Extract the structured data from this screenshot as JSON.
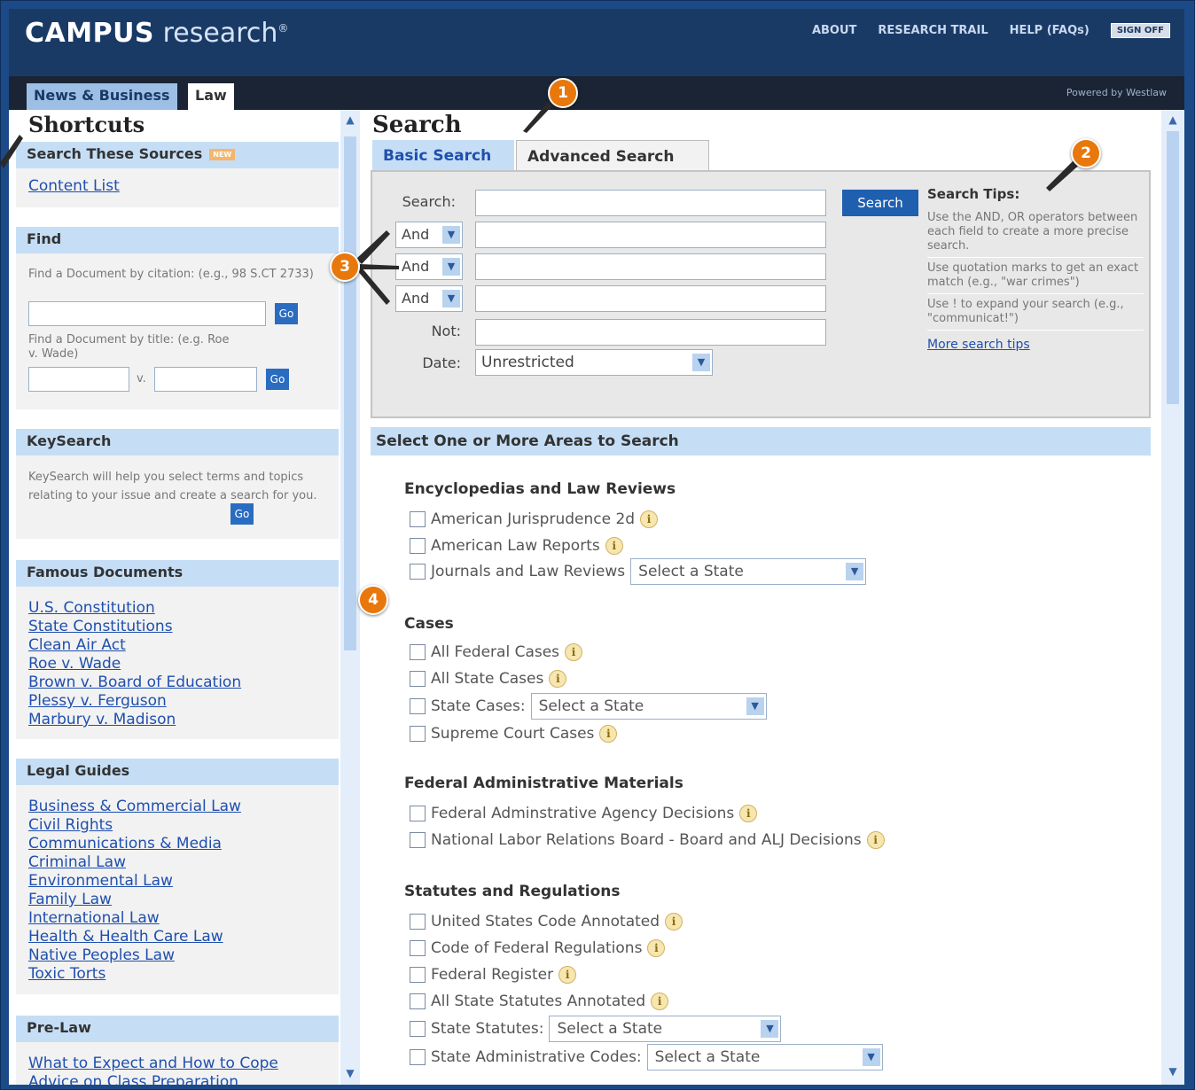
{
  "app": {
    "logo_bold": "CAMPUS",
    "logo_light": "research",
    "logo_mark": "®",
    "nav": [
      "ABOUT",
      "RESEARCH TRAIL",
      "HELP (FAQs)"
    ],
    "signoff": "SIGN OFF",
    "powered": "Powered by Westlaw",
    "tabs": [
      "News & Business",
      "Law"
    ]
  },
  "shortcuts": {
    "title": "Shortcuts",
    "sources_head": "Search These Sources",
    "new_badge": "NEW",
    "content_list": "Content List",
    "find_head": "Find",
    "find_citation_label": "Find a Document by citation: (e.g., 98 S.CT 2733)",
    "find_title_label": "Find a Document by title: (e.g. Roe v. Wade)",
    "v_label": "v.",
    "go": "Go",
    "keysearch_head": "KeySearch",
    "keysearch_text": "KeySearch will help you select terms and topics relating to your issue and create a search for you.",
    "famous_head": "Famous Documents",
    "famous": [
      "U.S. Constitution",
      "State Constitutions",
      "Clean Air Act",
      "Roe v. Wade",
      "Brown v. Board of Education",
      "Plessy v. Ferguson",
      "Marbury v. Madison"
    ],
    "guides_head": "Legal Guides",
    "guides": [
      "Business & Commercial Law",
      "Civil Rights",
      "Communications & Media",
      "Criminal Law",
      "Environmental Law",
      "Family Law",
      "International Law",
      "Health & Health Care Law",
      "Native Peoples Law",
      "Toxic Torts"
    ],
    "prelaw_head": "Pre-Law",
    "prelaw": [
      "What to Expect and How to Cope",
      "Advice on Class Preparation"
    ]
  },
  "search": {
    "title": "Search",
    "tab_basic": "Basic Search",
    "tab_advanced": "Advanced Search",
    "search_label": "Search:",
    "operators": [
      "And",
      "And",
      "And"
    ],
    "not_label": "Not:",
    "date_label": "Date:",
    "date_value": "Unrestricted",
    "button": "Search",
    "tips_title": "Search Tips:",
    "tips": [
      "Use the AND, OR operators between each field to create a more precise search.",
      "Use quotation marks to get an exact match (e.g., \"war crimes\")",
      "Use ! to expand your search (e.g., \"communicat!\")"
    ],
    "tips_link": "More search tips"
  },
  "areas": {
    "head": "Select One or More Areas to Search",
    "state_select": "Select a State",
    "info": "i",
    "groups": [
      {
        "title": "Encyclopedias and Law Reviews",
        "items": [
          "American Jurisprudence 2d",
          "American Law Reports",
          "Journals and Law Reviews"
        ]
      },
      {
        "title": "Cases",
        "items": [
          "All Federal Cases",
          "All State Cases",
          "State Cases:",
          "Supreme Court Cases"
        ]
      },
      {
        "title": "Federal Administrative Materials",
        "items": [
          "Federal Adminstrative Agency Decisions",
          "National Labor Relations Board - Board and ALJ Decisions"
        ]
      },
      {
        "title": "Statutes and Regulations",
        "items": [
          "United States Code Annotated",
          "Code of Federal Regulations",
          "Federal Register",
          "All State Statutes Annotated",
          "State Statutes:",
          "State Administrative Codes:"
        ]
      }
    ]
  },
  "callouts": [
    "1",
    "2",
    "3",
    "4"
  ],
  "colors": {
    "header": "#1a3a66",
    "accent": "#1f5fb0",
    "section": "#c5def6",
    "callout": "#e8780c"
  }
}
